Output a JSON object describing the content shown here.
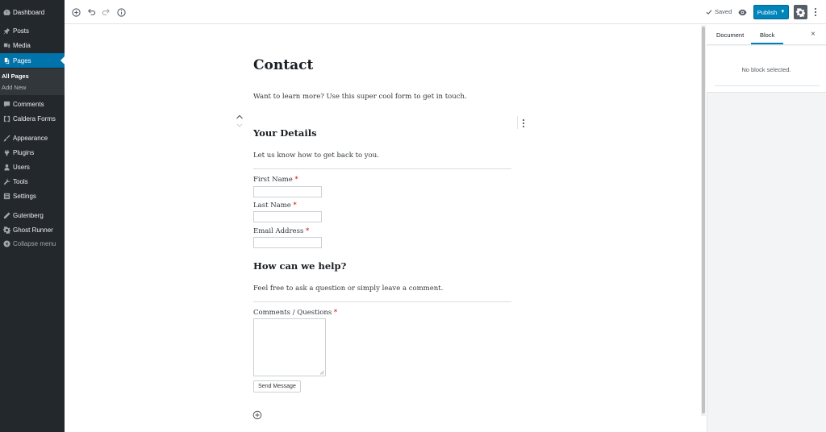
{
  "sidebar": {
    "items": [
      {
        "label": "Dashboard",
        "icon": "dashboard-icon"
      },
      {
        "label": "Posts",
        "icon": "pin-icon"
      },
      {
        "label": "Media",
        "icon": "media-icon"
      },
      {
        "label": "Pages",
        "icon": "pages-icon"
      },
      {
        "label": "Comments",
        "icon": "comment-icon"
      },
      {
        "label": "Caldera Forms",
        "icon": "caldera-icon"
      },
      {
        "label": "Appearance",
        "icon": "brush-icon"
      },
      {
        "label": "Plugins",
        "icon": "plugin-icon"
      },
      {
        "label": "Users",
        "icon": "user-icon"
      },
      {
        "label": "Tools",
        "icon": "wrench-icon"
      },
      {
        "label": "Settings",
        "icon": "settings-icon"
      },
      {
        "label": "Gutenberg",
        "icon": "pencil-icon"
      },
      {
        "label": "Ghost Runner",
        "icon": "gear-icon"
      },
      {
        "label": "Collapse menu",
        "icon": "collapse-icon"
      }
    ],
    "submenu": [
      "All Pages",
      "Add New"
    ]
  },
  "topbar": {
    "saved": "Saved",
    "publish": "Publish"
  },
  "content": {
    "title": "Contact",
    "intro": "Want to learn more? Use this super cool form to get in touch.",
    "section1_heading": "Your Details",
    "section1_text": "Let us know how to get back to you.",
    "first_name": "First Name",
    "last_name": "Last Name",
    "email": "Email Address",
    "required_mark": "*",
    "section2_heading": "How can we help?",
    "section2_text": "Feel free to ask a question or simply leave a comment.",
    "comments": "Comments / Questions",
    "send": "Send Message"
  },
  "panel": {
    "tab_document": "Document",
    "tab_block": "Block",
    "close": "×",
    "empty": "No block selected."
  },
  "colors": {
    "sidebar_bg": "#23282d",
    "accent": "#0073aa",
    "publish": "#0085ba"
  }
}
